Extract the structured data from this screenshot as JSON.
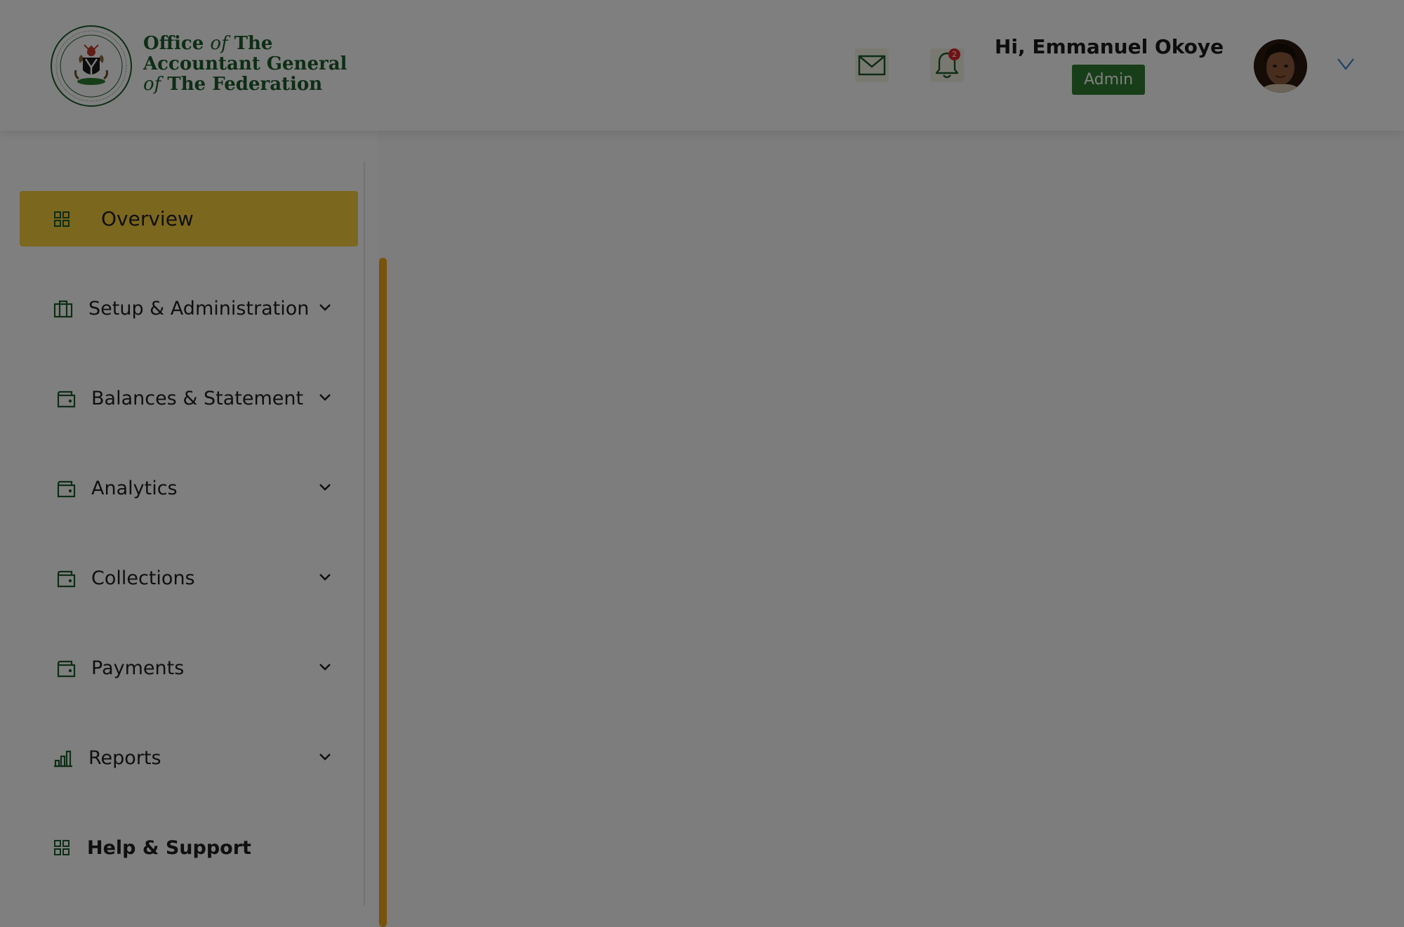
{
  "header": {
    "brand": {
      "line1_a": "Office",
      "line1_b": "of",
      "line1_c": "The",
      "line2": "Accountant General",
      "line3_a": "of",
      "line3_b": "The Federation"
    },
    "greeting": "Hi, Emmanuel Okoye",
    "role": "Admin",
    "notification_count": "2"
  },
  "sidebar": {
    "items": [
      {
        "label": "Overview",
        "icon": "grid-icon",
        "active": true
      },
      {
        "label": "Setup & Administration",
        "icon": "briefcase-icon",
        "expandable": true
      },
      {
        "label": "Balances & Statement",
        "icon": "wallet-icon",
        "expandable": true
      },
      {
        "label": "Analytics",
        "icon": "wallet-icon",
        "expandable": true
      },
      {
        "label": "Collections",
        "icon": "wallet-icon",
        "expandable": true
      },
      {
        "label": "Payments",
        "icon": "wallet-icon",
        "expandable": true
      },
      {
        "label": "Reports",
        "icon": "bar-chart-icon",
        "expandable": true
      },
      {
        "label": "Help & Support",
        "icon": "grid-icon",
        "expandable": false
      }
    ]
  },
  "colors": {
    "brand_green": "#1c5a2a",
    "badge_green": "#2e7d32",
    "accent_gold": "#f2a516",
    "active_yellow": "#f7cf3d",
    "notification_red": "#e0242a",
    "overlay": "rgba(0,0,0,0.5)"
  }
}
